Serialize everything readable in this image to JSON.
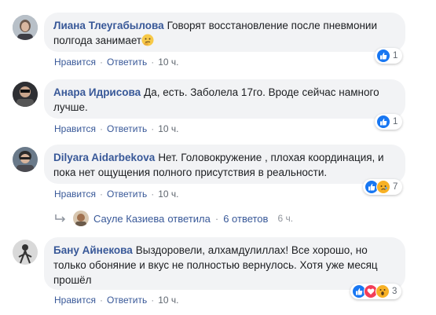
{
  "comments": [
    {
      "author": "Лиана Тлеугабылова",
      "text": "Говорят восстановление после пневмонии полгода занимает",
      "like_label": "Нравится",
      "reply_label": "Ответить",
      "time": "10 ч.",
      "reaction_count": "1",
      "reactions": [
        "like-icon"
      ],
      "trailing_emoji": "thinking-face-icon"
    },
    {
      "author": "Анара Идрисова",
      "text": "Да, есть. Заболела 17го. Вроде сейчас намного лучше.",
      "like_label": "Нравится",
      "reply_label": "Ответить",
      "time": "10 ч.",
      "reaction_count": "1",
      "reactions": [
        "like-icon"
      ]
    },
    {
      "author": "Dilyara Aidarbekova",
      "text": "Нет. Головокружение , плохая координация, и пока нет ощущения полного присутствия в реальности.",
      "like_label": "Нравится",
      "reply_label": "Ответить",
      "time": "10 ч.",
      "reaction_count": "7",
      "reactions": [
        "like-icon",
        "sad-icon"
      ]
    },
    {
      "author": "Бану Айнекова",
      "text": "Выздоровели, алхамдулиллах! Все хорошо, но только обоняние и вкус не полностью вернулось. Хотя уже месяц прошёл",
      "like_label": "Нравится",
      "reply_label": "Ответить",
      "time": "10 ч.",
      "reaction_count": "3",
      "reactions": [
        "like-icon",
        "love-icon",
        "wow-icon"
      ]
    }
  ],
  "reply_thread": {
    "name": "Сауле Казиева",
    "action": "ответила",
    "count": "6 ответов",
    "time": "6 ч."
  },
  "colors": {
    "link": "#385898",
    "bubble": "#f2f3f5",
    "like": "#1877f2",
    "love": "#f33e58",
    "sad": "#f7b125"
  }
}
